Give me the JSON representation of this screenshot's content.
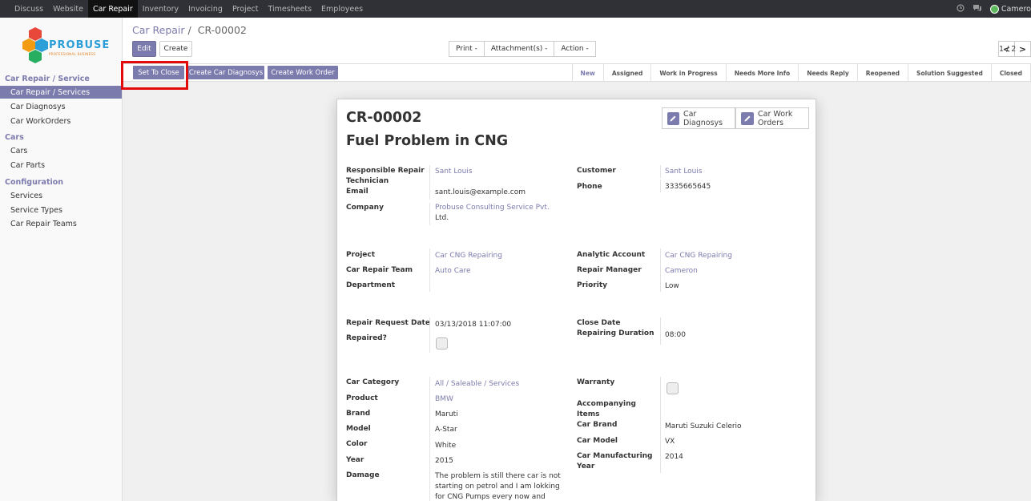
{
  "topbar": {
    "menus": [
      "Discuss",
      "Website",
      "Car Repair",
      "Inventory",
      "Invoicing",
      "Project",
      "Timesheets",
      "Employees"
    ],
    "user": "Camero"
  },
  "logo": {
    "brand": "PROBUSE",
    "tagline": "PROFESSIONAL BUSINESS"
  },
  "sidebar": {
    "sections": [
      {
        "title": "Car Repair / Service",
        "items": [
          "Car Repair / Services",
          "Car Diagnosys",
          "Car WorkOrders"
        ]
      },
      {
        "title": "Cars",
        "items": [
          "Cars",
          "Car Parts"
        ]
      },
      {
        "title": "Configuration",
        "items": [
          "Services",
          "Service Types",
          "Car Repair Teams"
        ]
      }
    ],
    "active_item": "Car Repair / Services"
  },
  "breadcrumb": {
    "parent": "Car Repair",
    "sep": "/",
    "current": "CR-00002"
  },
  "buttons": {
    "edit": "Edit",
    "create": "Create",
    "print": "Print -",
    "attachments": "Attachment(s) -",
    "action": "Action -"
  },
  "pager": {
    "value": "1 / 2",
    "prev": "<",
    "next": ">"
  },
  "header_buttons": [
    "Set To Close",
    "Create Car Diagnosys",
    "Create Work Order"
  ],
  "stages": [
    "New",
    "Assigned",
    "Work in Progress",
    "Needs More Info",
    "Needs Reply",
    "Reopened",
    "Solution Suggested",
    "Closed"
  ],
  "active_stage": "New",
  "smart_buttons": {
    "diagnosys": "Car Diagnosys",
    "work_orders_1": "Car Work",
    "work_orders_2": "Orders"
  },
  "form": {
    "name": "CR-00002",
    "subject": "Fuel Problem in CNG",
    "labels": {
      "technician_1": "Responsible Repair",
      "technician_2": "Technician",
      "email": "Email",
      "company": "Company",
      "customer": "Customer",
      "phone": "Phone",
      "project": "Project",
      "team": "Car Repair Team",
      "department": "Department",
      "analytic": "Analytic Account",
      "manager": "Repair Manager",
      "priority": "Priority",
      "request_date": "Repair Request Date",
      "repaired": "Repaired?",
      "close_date": "Close Date",
      "duration": "Repairing Duration",
      "category": "Car Category",
      "product": "Product",
      "brand": "Brand",
      "model": "Model",
      "color": "Color",
      "year": "Year",
      "damage": "Damage",
      "warranty": "Warranty",
      "accompanying_1": "Accompanying",
      "accompanying_2": "Items",
      "car_brand": "Car Brand",
      "car_model": "Car Model",
      "manufacturing_1": "Car Manufacturing",
      "manufacturing_2": "Year"
    },
    "values": {
      "technician": "Sant Louis",
      "email": "sant.louis@example.com",
      "company_1": "Probuse Consulting Service Pvt.",
      "company_2": "Ltd.",
      "customer": "Sant Louis",
      "phone": "3335665645",
      "project": "Car CNG Repairing",
      "team": "Auto Care",
      "analytic": "Car CNG Repairing",
      "manager": "Cameron",
      "priority": "Low",
      "request_date": "03/13/2018 11:07:00",
      "duration": "08:00",
      "category": "All / Saleable / Services",
      "product": "BMW",
      "brand": "Maruti",
      "model": "A-Star",
      "color": "White",
      "year": "2015",
      "damage_1": "The problem is still there car is not",
      "damage_2": "starting on petrol and I am lokking",
      "damage_3": "for CNG Pumps every now and",
      "car_brand": "Maruti Suzuki Celerio",
      "car_model": "VX",
      "manufacturing_year": "2014"
    },
    "repaired_checked": false,
    "warranty_checked": false
  },
  "colors": {
    "primary": "#7c7bad",
    "topbar": "#2f3136",
    "highlight": "#e20a0a"
  }
}
